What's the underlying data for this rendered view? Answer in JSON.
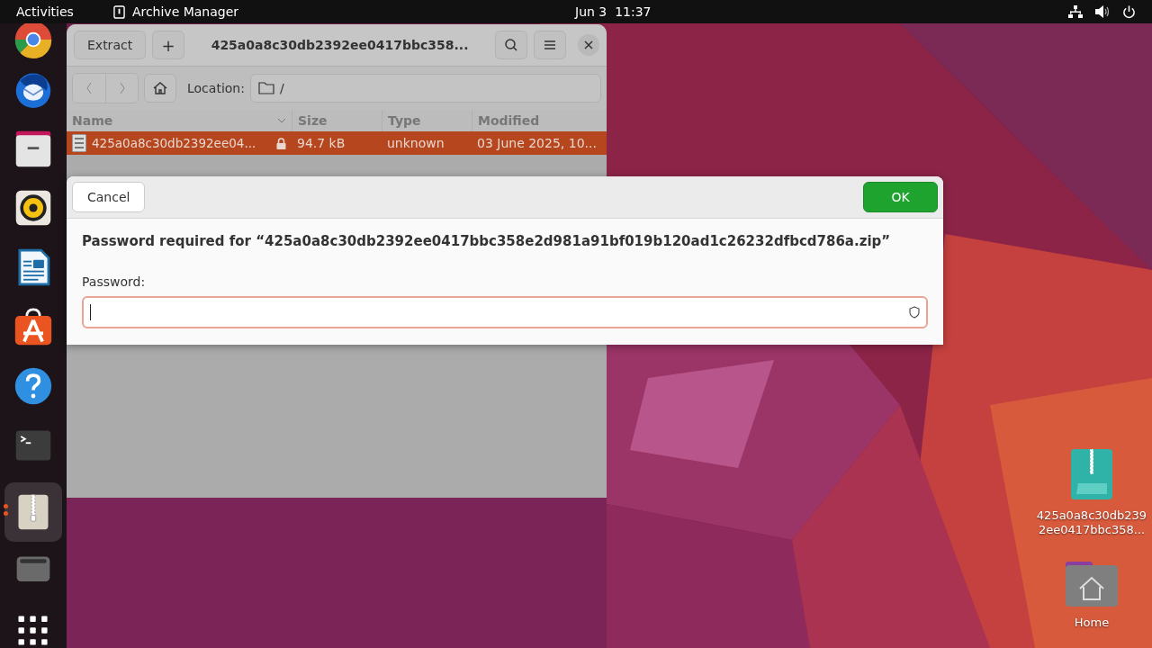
{
  "top_bar": {
    "activities": "Activities",
    "app_name": "Archive Manager",
    "clock": "Jun 3  11:37"
  },
  "dock": {
    "items": [
      {
        "kind": "browser",
        "running": false
      },
      {
        "kind": "mail",
        "running": false
      },
      {
        "kind": "files",
        "running": false
      },
      {
        "kind": "music",
        "running": false
      },
      {
        "kind": "writer",
        "running": false
      },
      {
        "kind": "store",
        "running": false
      },
      {
        "kind": "help",
        "running": false
      },
      {
        "kind": "terminal",
        "running": false
      },
      {
        "kind": "archive",
        "running": true
      },
      {
        "kind": "disk",
        "running": false
      },
      {
        "kind": "apps",
        "running": false
      }
    ]
  },
  "archive_window": {
    "extract_button": "Extract",
    "add_button": "+",
    "title": "425a0a8c30db2392ee0417bbc358...",
    "location_label": "Location:",
    "location": "/",
    "columns": [
      "Name",
      "Size",
      "Type",
      "Modified"
    ],
    "rows": [
      {
        "name": "425a0a8c30db2392ee04...",
        "size": "94.7 kB",
        "type": "unknown",
        "modified": "03 June 2025, 10...",
        "selected": true,
        "locked": true
      }
    ]
  },
  "password_dialog": {
    "cancel_button": "Cancel",
    "ok_button": "OK",
    "message": "Password required for “425a0a8c30db2392ee0417bbc358e2d981a91bf019b120ad1c26232dfbcd786a.zip”",
    "field_label": "Password:"
  },
  "desktop_icons": [
    {
      "kind": "zip",
      "label": "425a0a8c30db2392ee0417bbc358..."
    },
    {
      "kind": "home",
      "label": "Home"
    }
  ]
}
